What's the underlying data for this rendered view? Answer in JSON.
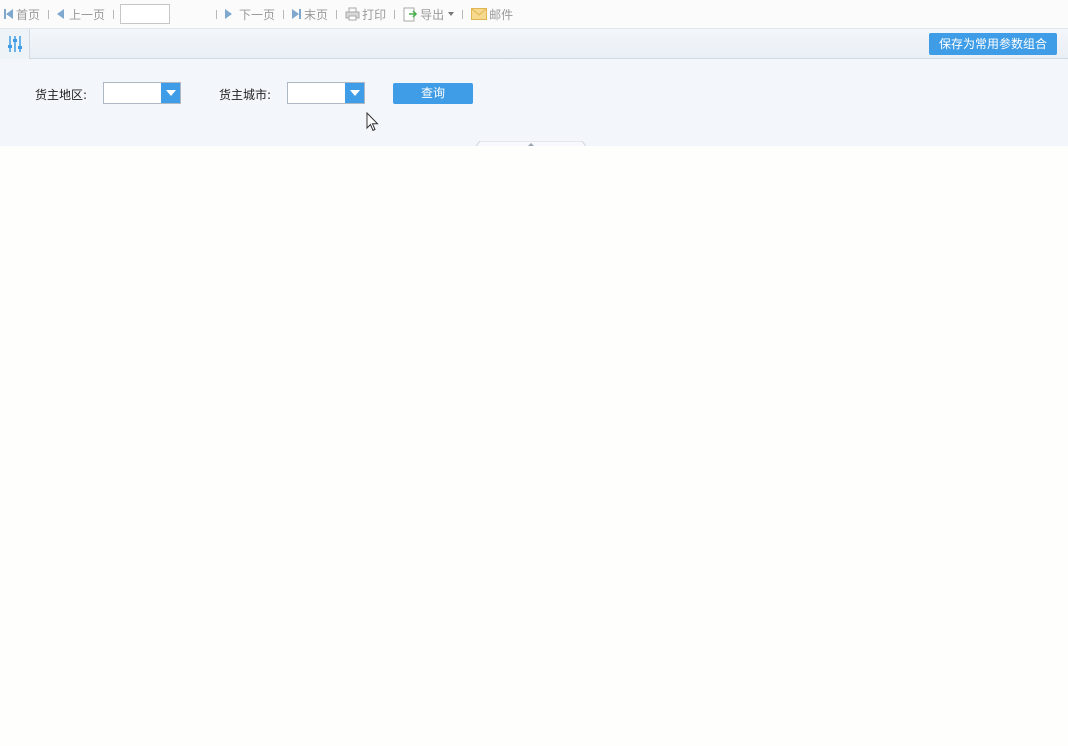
{
  "toolbar": {
    "first": "首页",
    "prev": "上一页",
    "page_value": "",
    "next": "下一页",
    "last": "末页",
    "print": "打印",
    "export": "导出",
    "mail": "邮件"
  },
  "params": {
    "save_label": "保存为常用参数组合",
    "region_label": "货主地区:",
    "region_value": "",
    "city_label": "货主城市:",
    "city_value": "",
    "query_label": "查询"
  },
  "colors": {
    "accent": "#3f9ce6",
    "toolbar_text": "#9a9a9a"
  }
}
